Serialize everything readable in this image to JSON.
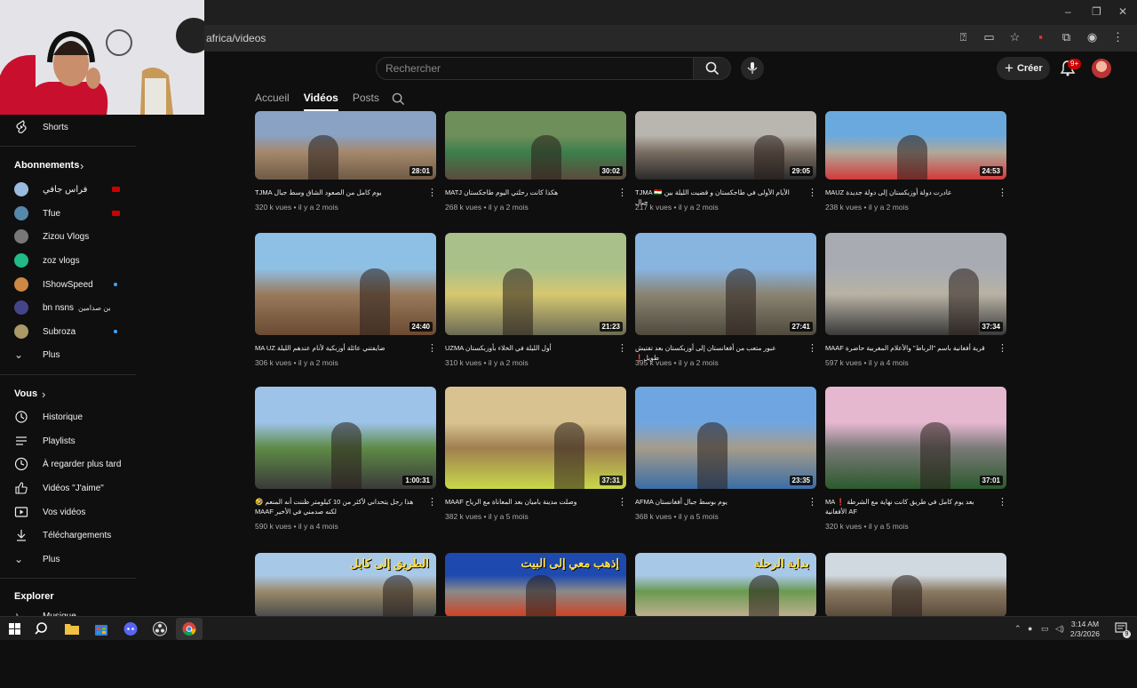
{
  "browser": {
    "url": "africa/videos",
    "window_controls": [
      "–",
      "❐"
    ]
  },
  "header": {
    "search_placeholder": "Rechercher",
    "create_label": "Créer",
    "notification_badge": "9+"
  },
  "tabs": [
    {
      "label": "Accueil",
      "active": false
    },
    {
      "label": "Vidéos",
      "active": true
    },
    {
      "label": "Posts",
      "active": false
    }
  ],
  "sidebar": {
    "shorts": "Shorts",
    "subscriptions_heading": "Abonnements",
    "subscriptions": [
      {
        "name": "فراس جافي",
        "indicator": "live",
        "color": "#9bd"
      },
      {
        "name": "Tfue",
        "indicator": "live",
        "color": "#58a"
      },
      {
        "name": "Zizou Vlogs",
        "indicator": "",
        "color": "#777"
      },
      {
        "name": "zoz vlogs",
        "indicator": "",
        "color": "#2b8"
      },
      {
        "name": "IShowSpeed",
        "indicator": "dot",
        "color": "#c84"
      },
      {
        "name": "bn nsns",
        "extra": "بن صدامين",
        "indicator": "",
        "color": "#448"
      },
      {
        "name": "Subroza",
        "indicator": "dot",
        "color": "#a96"
      }
    ],
    "more_subs": "Plus",
    "you_heading": "Vous",
    "you_items": [
      "Historique",
      "Playlists",
      "À regarder plus tard",
      "Vidéos \"J'aime\"",
      "Vos vidéos",
      "Téléchargements",
      "Plus"
    ],
    "explore_heading": "Explorer",
    "explore_items": [
      "Musique"
    ]
  },
  "videos": [
    {
      "title": "يوم كامل من الصعود الشاق وسط جبال TJMA",
      "views": "320 k vues",
      "age": "il y a 2 mois",
      "duration": "28:01",
      "colors": [
        "#8aa2c4",
        "#a4886b",
        "#6f5a45"
      ]
    },
    {
      "title": "هكذا كانت رحلتي اليوم طاجكستان MATJ",
      "views": "268 k vues",
      "age": "il y a 2 mois",
      "duration": "30:02",
      "colors": [
        "#6f8f5a",
        "#3c7f4c",
        "#5c4a3c"
      ]
    },
    {
      "title": "TJMA 🇹🇯 الأيام الأولى في طاجكستان و قضيت الليلة بين جبال",
      "views": "217 k vues",
      "age": "il y a 2 mois",
      "duration": "29:05",
      "colors": [
        "#b9b6b0",
        "#7a6d62",
        "#2a2a2a"
      ]
    },
    {
      "title": "MAUZ عادرت دولة أوزبكستان إلى دولة جديدة",
      "views": "238 k vues",
      "age": "il y a 2 mois",
      "duration": "24:53",
      "colors": [
        "#6aa9dd",
        "#b0a89a",
        "#d23a3a"
      ]
    },
    {
      "title": "MA UZ ضايفتني عائلة أوزبكية لأنام عندهم الليلة",
      "views": "306 k vues",
      "age": "il y a 2 mois",
      "duration": "24:40",
      "colors": [
        "#8ec0e6",
        "#9a7a5b",
        "#6a4a32"
      ]
    },
    {
      "title": "UZMA أول الليلة في الخلاء بأوزبكستان",
      "views": "310 k vues",
      "age": "il y a 2 mois",
      "duration": "21:23",
      "colors": [
        "#a9c08a",
        "#d6c870",
        "#6b6b55"
      ]
    },
    {
      "title": "عبور متعب من أفغانستان إلى أوزبكستان بعد تفتيش طويل❗️",
      "views": "395 k vues",
      "age": "il y a 2 mois",
      "duration": "27:41",
      "colors": [
        "#88b4e0",
        "#8a8472",
        "#4f4a3e"
      ]
    },
    {
      "title": "MAAF قرية أفغانية باسم \"الرباط\" والأعلام المغربية حاضرة",
      "views": "597 k vues",
      "age": "il y a 4 mois",
      "duration": "37:34",
      "colors": [
        "#a8acb2",
        "#b8b2a4",
        "#3a3a3a"
      ]
    },
    {
      "title": "هذا رجل يتحداني لأكثر من 10 كيلومتر ظننت أنه المنعم 🤣 لكنه صدمني في الأخير MAAF",
      "views": "590 k vues",
      "age": "il y a 4 mois",
      "duration": "1:00:31",
      "colors": [
        "#9dc3e8",
        "#5e8a46",
        "#3a3a3a"
      ]
    },
    {
      "title": "MAAF وصلت مدينة باميان بعد المعاناة مع الرياح",
      "views": "382 k vues",
      "age": "il y a 5 mois",
      "duration": "37:31",
      "colors": [
        "#d8c390",
        "#a07f4f",
        "#c8d84a"
      ]
    },
    {
      "title": "AFMA يوم بوسط جبال أفغانستان",
      "views": "368 k vues",
      "age": "il y a 5 mois",
      "duration": "23:35",
      "colors": [
        "#6fa6e2",
        "#a59c8a",
        "#3b6ea5"
      ]
    },
    {
      "title": "MA ❗️ بعد يوم كامل في طريق كانت نهاية مع الشرطة الأفغانية AF",
      "views": "320 k vues",
      "age": "il y a 5 mois",
      "duration": "37:01",
      "colors": [
        "#e6b8d0",
        "#7a7a78",
        "#2d5a2d"
      ]
    },
    {
      "title": "",
      "views": "",
      "age": "",
      "duration": "",
      "overlay": "الطريق إلى كابل",
      "colors": [
        "#a8c8e8",
        "#9a8a6a",
        "#4a4a4a"
      ]
    },
    {
      "title": "",
      "views": "",
      "age": "",
      "duration": "",
      "overlay": "إذهب معي إلى البيت",
      "colors": [
        "#1e4ab0",
        "#8a8a8a",
        "#d04020"
      ]
    },
    {
      "title": "",
      "views": "",
      "age": "",
      "duration": "",
      "overlay": "بداية الرحلة",
      "colors": [
        "#a8c8e8",
        "#6a9a50",
        "#c0b090"
      ]
    },
    {
      "title": "",
      "views": "",
      "age": "",
      "duration": "",
      "colors": [
        "#d0d8e0",
        "#8a7a62",
        "#5a4a3a"
      ]
    }
  ],
  "taskbar": {
    "time": "3:14 AM",
    "date": "2/3/2026",
    "notif_count": "9"
  }
}
